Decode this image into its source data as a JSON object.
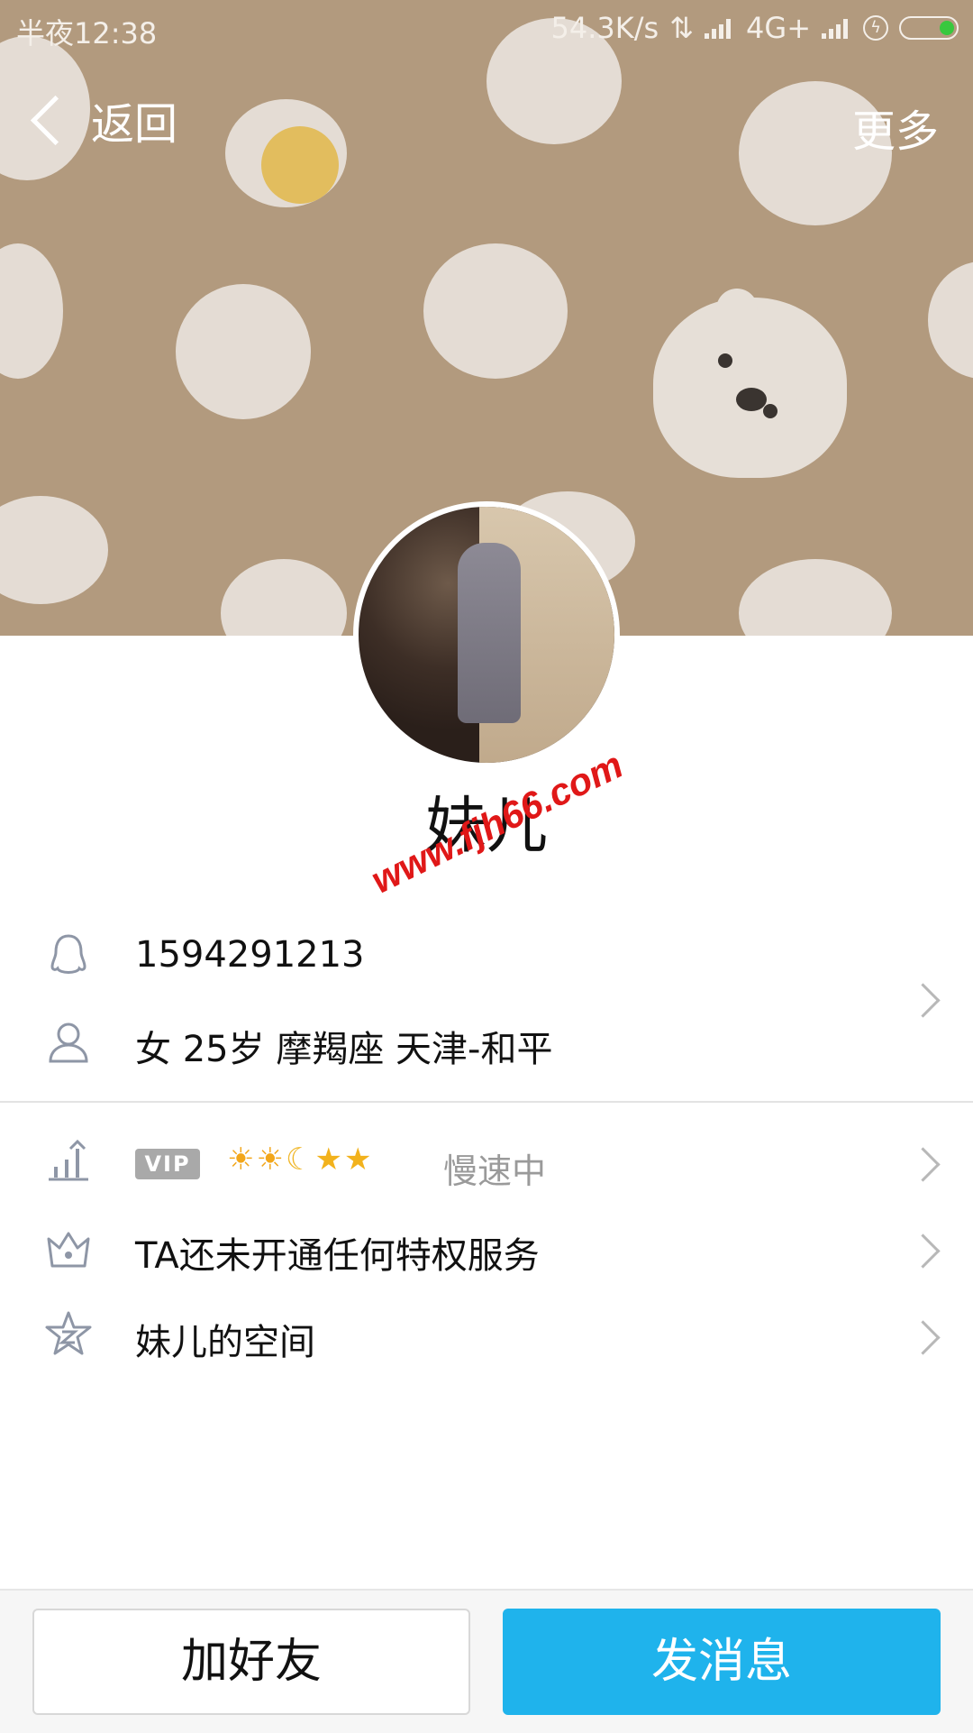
{
  "status_bar": {
    "time": "半夜12:38",
    "network_speed": "54.3K/s",
    "network_type": "4G+"
  },
  "nav": {
    "back_label": "返回",
    "more_label": "更多"
  },
  "profile": {
    "name": "妹儿",
    "qq_number": "1594291213",
    "details": "女  25岁  摩羯座  天津-和平"
  },
  "watermark": "www.fjh66.com",
  "level": {
    "vip_badge": "VIP",
    "icons": [
      "sun",
      "sun",
      "moon",
      "star",
      "star"
    ],
    "speed_status": "慢速中"
  },
  "privilege": {
    "label": "TA还未开通任何特权服务"
  },
  "zone": {
    "label": "妹儿的空间"
  },
  "actions": {
    "add_friend": "加好友",
    "send_message": "发消息"
  },
  "colors": {
    "cover": "#b29a7e",
    "primary_button": "#1fb3ec"
  }
}
